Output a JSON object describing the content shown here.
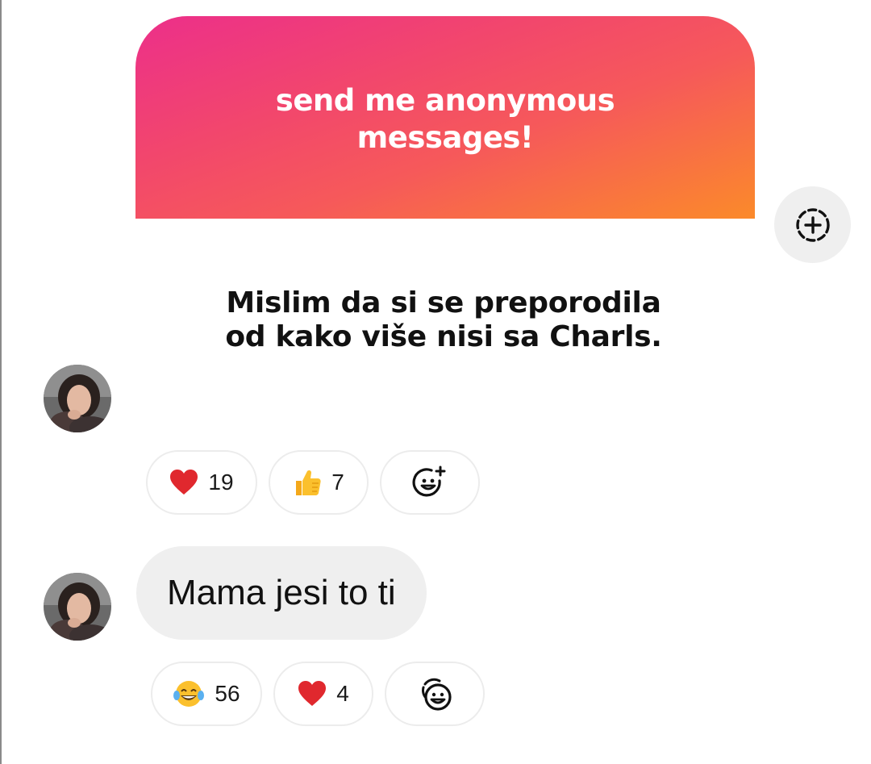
{
  "story_card": {
    "title": "send me anonymous\nmessages!"
  },
  "question": {
    "text": "Mislim da si se preporodila\nod kako više nisi sa Charls."
  },
  "reactions_1": [
    {
      "emoji": "heart",
      "count": "19"
    },
    {
      "emoji": "thumbs-up",
      "count": "7"
    }
  ],
  "message": {
    "text": "Mama jesi to ti"
  },
  "reactions_2": [
    {
      "emoji": "laughing-tears",
      "count": "56"
    },
    {
      "emoji": "heart",
      "count": "4"
    }
  ],
  "colors": {
    "gradient_start": "#ec2f8a",
    "gradient_end": "#fb8a2a",
    "bubble_bg": "#efefef",
    "heart": "#e0282e"
  }
}
